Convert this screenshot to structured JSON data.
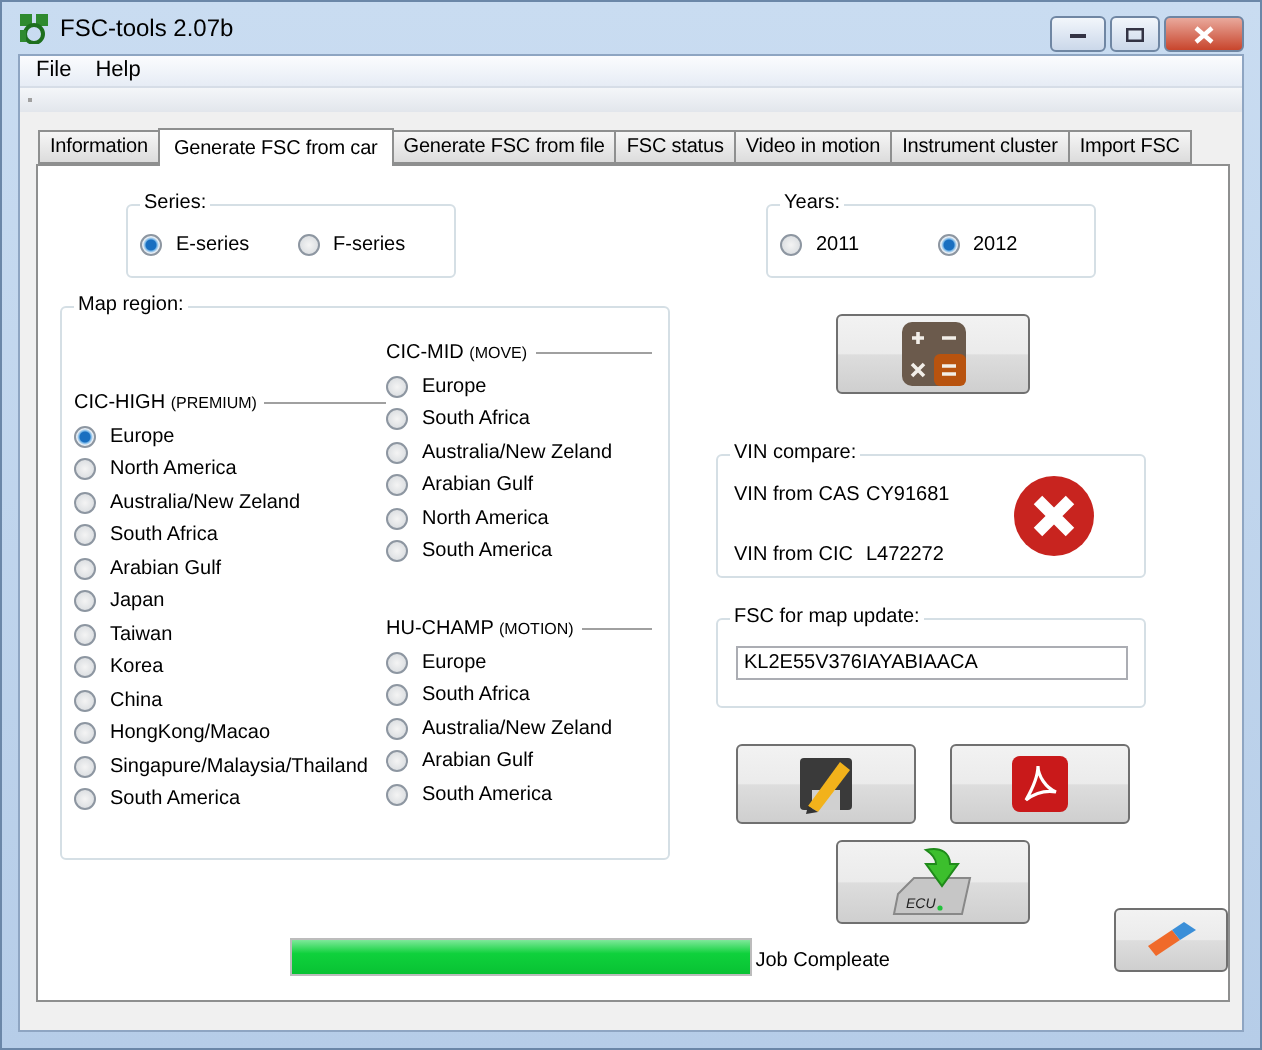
{
  "window": {
    "title": "FSC-tools 2.07b"
  },
  "menu": [
    "File",
    "Help"
  ],
  "tabs": [
    {
      "label": "Information",
      "selected": false
    },
    {
      "label": "Generate FSC from car",
      "selected": true
    },
    {
      "label": "Generate FSC from file",
      "selected": false
    },
    {
      "label": "FSC status",
      "selected": false
    },
    {
      "label": "Video in motion",
      "selected": false
    },
    {
      "label": "Instrument cluster",
      "selected": false
    },
    {
      "label": "Import FSC",
      "selected": false
    }
  ],
  "series": {
    "label": "Series:",
    "options": [
      {
        "label": "E-series",
        "selected": true
      },
      {
        "label": "F-series",
        "selected": false
      }
    ]
  },
  "years": {
    "label": "Years:",
    "options": [
      {
        "label": "2011",
        "selected": false
      },
      {
        "label": "2012",
        "selected": true
      }
    ]
  },
  "map_region": {
    "label": "Map region:",
    "groups": [
      {
        "name": "CIC-HIGH",
        "tag": "(PREMIUM)",
        "options": [
          {
            "label": "Europe",
            "selected": true
          },
          {
            "label": "North America",
            "selected": false
          },
          {
            "label": "Australia/New Zeland",
            "selected": false
          },
          {
            "label": "South Africa",
            "selected": false
          },
          {
            "label": "Arabian Gulf",
            "selected": false
          },
          {
            "label": "Japan",
            "selected": false
          },
          {
            "label": "Taiwan",
            "selected": false
          },
          {
            "label": "Korea",
            "selected": false
          },
          {
            "label": "China",
            "selected": false
          },
          {
            "label": "HongKong/Macao",
            "selected": false
          },
          {
            "label": "Singapure/Malaysia/Thailand",
            "selected": false
          },
          {
            "label": "South America",
            "selected": false
          }
        ]
      },
      {
        "name": "CIC-MID",
        "tag": "(MOVE)",
        "options": [
          {
            "label": "Europe",
            "selected": false
          },
          {
            "label": "South Africa",
            "selected": false
          },
          {
            "label": "Australia/New Zeland",
            "selected": false
          },
          {
            "label": "Arabian Gulf",
            "selected": false
          },
          {
            "label": "North America",
            "selected": false
          },
          {
            "label": "South America",
            "selected": false
          }
        ]
      },
      {
        "name": "HU-CHAMP",
        "tag": "(MOTION)",
        "options": [
          {
            "label": "Europe",
            "selected": false
          },
          {
            "label": "South Africa",
            "selected": false
          },
          {
            "label": "Australia/New Zeland",
            "selected": false
          },
          {
            "label": "Arabian Gulf",
            "selected": false
          },
          {
            "label": "South America",
            "selected": false
          }
        ]
      }
    ]
  },
  "vin_compare": {
    "label": "VIN compare:",
    "rows": [
      {
        "label": "VIN from CAS",
        "value": "CY91681"
      },
      {
        "label": "VIN from CIC",
        "value": "L472272"
      }
    ],
    "match": false
  },
  "fsc": {
    "label": "FSC for map update:",
    "value": "KL2E55V376IAYABIAACA"
  },
  "ecu_label": "ECU",
  "progress": {
    "level": 1,
    "status": "Job Compleate"
  }
}
